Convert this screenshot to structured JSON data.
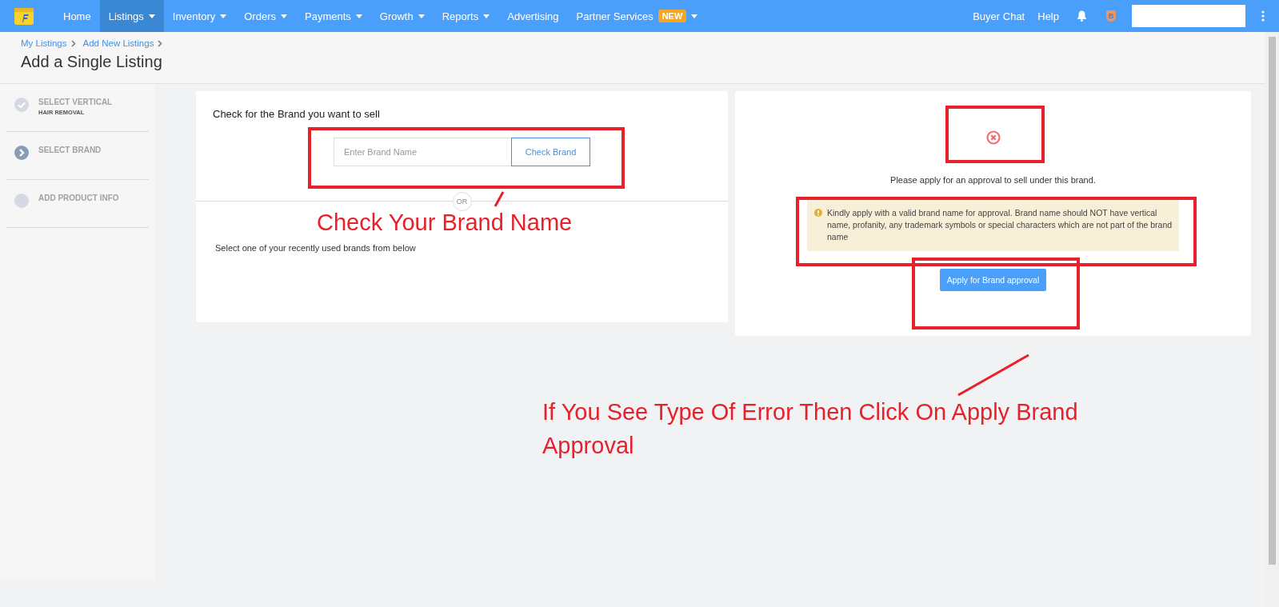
{
  "navbar": {
    "items": [
      {
        "label": "Home",
        "selected": false,
        "dropdown": false
      },
      {
        "label": "Listings",
        "selected": true,
        "dropdown": true
      },
      {
        "label": "Inventory",
        "selected": false,
        "dropdown": true
      },
      {
        "label": "Orders",
        "selected": false,
        "dropdown": true
      },
      {
        "label": "Payments",
        "selected": false,
        "dropdown": true
      },
      {
        "label": "Growth",
        "selected": false,
        "dropdown": true
      },
      {
        "label": "Reports",
        "selected": false,
        "dropdown": true
      },
      {
        "label": "Advertising",
        "selected": false,
        "dropdown": false
      },
      {
        "label": "Partner Services",
        "selected": false,
        "dropdown": true,
        "badge": "NEW"
      }
    ],
    "right_links": [
      "Buyer Chat",
      "Help"
    ],
    "badge_letter": "B"
  },
  "breadcrumb": [
    "My Listings",
    "Add New Listings"
  ],
  "page_title": "Add a Single Listing",
  "steps": [
    {
      "title": "SELECT VERTICAL",
      "subtitle": "HAIR REMOVAL",
      "kind": "done"
    },
    {
      "title": "SELECT BRAND",
      "kind": "current"
    },
    {
      "title": "ADD PRODUCT INFO",
      "kind": "pending"
    }
  ],
  "brand_card": {
    "heading": "Check for the Brand you want to sell",
    "placeholder": "Enter Brand Name",
    "button": "Check Brand",
    "divider": "OR",
    "recent_text": "Select one of your recently used brands from below"
  },
  "result_card": {
    "message": "Please apply for an approval to sell under this brand.",
    "warning": "Kindly apply with a valid brand name for approval. Brand name should NOT have vertical name, profanity, any trademark symbols or special characters which are not part of the brand name",
    "button": "Apply for Brand approval"
  },
  "annotations": [
    {
      "text": "Check Your Brand Name"
    },
    {
      "text": "If You See Type Of Error Then Click On Apply Brand Approval"
    }
  ]
}
